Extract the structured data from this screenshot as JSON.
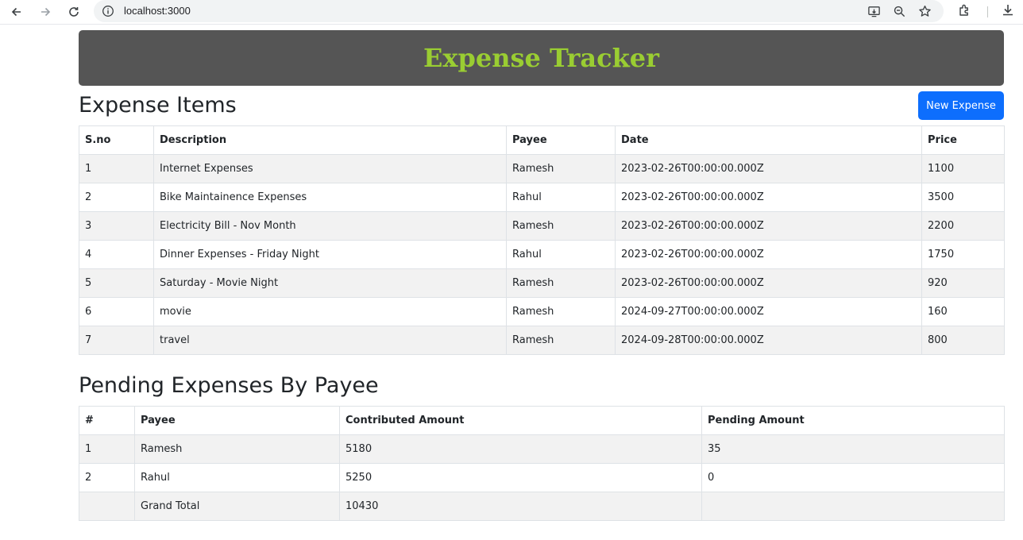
{
  "browser": {
    "url": "localhost:3000"
  },
  "app": {
    "title": "Expense Tracker",
    "header_bg": "#555555",
    "title_color": "#9acd32"
  },
  "expenses": {
    "heading": "Expense Items",
    "new_button": "New Expense",
    "button_color": "#0d6efd",
    "columns": [
      "S.no",
      "Description",
      "Payee",
      "Date",
      "Price"
    ],
    "rows": [
      {
        "sno": "1",
        "description": "Internet Expenses",
        "payee": "Ramesh",
        "date": "2023-02-26T00:00:00.000Z",
        "price": "1100"
      },
      {
        "sno": "2",
        "description": "Bike Maintainence Expenses",
        "payee": "Rahul",
        "date": "2023-02-26T00:00:00.000Z",
        "price": "3500"
      },
      {
        "sno": "3",
        "description": "Electricity Bill - Nov Month",
        "payee": "Ramesh",
        "date": "2023-02-26T00:00:00.000Z",
        "price": "2200"
      },
      {
        "sno": "4",
        "description": "Dinner Expenses - Friday Night",
        "payee": "Rahul",
        "date": "2023-02-26T00:00:00.000Z",
        "price": "1750"
      },
      {
        "sno": "5",
        "description": "Saturday - Movie Night",
        "payee": "Ramesh",
        "date": "2023-02-26T00:00:00.000Z",
        "price": "920"
      },
      {
        "sno": "6",
        "description": "movie",
        "payee": "Ramesh",
        "date": "2024-09-27T00:00:00.000Z",
        "price": "160"
      },
      {
        "sno": "7",
        "description": "travel",
        "payee": "Ramesh",
        "date": "2024-09-28T00:00:00.000Z",
        "price": "800"
      }
    ]
  },
  "pending": {
    "heading": "Pending Expenses By Payee",
    "columns": [
      "#",
      "Payee",
      "Contributed Amount",
      "Pending Amount"
    ],
    "rows": [
      {
        "num": "1",
        "payee": "Ramesh",
        "contributed": "5180",
        "pending": "35"
      },
      {
        "num": "2",
        "payee": "Rahul",
        "contributed": "5250",
        "pending": "0"
      },
      {
        "num": "",
        "payee": "Grand Total",
        "contributed": "10430",
        "pending": ""
      }
    ]
  }
}
